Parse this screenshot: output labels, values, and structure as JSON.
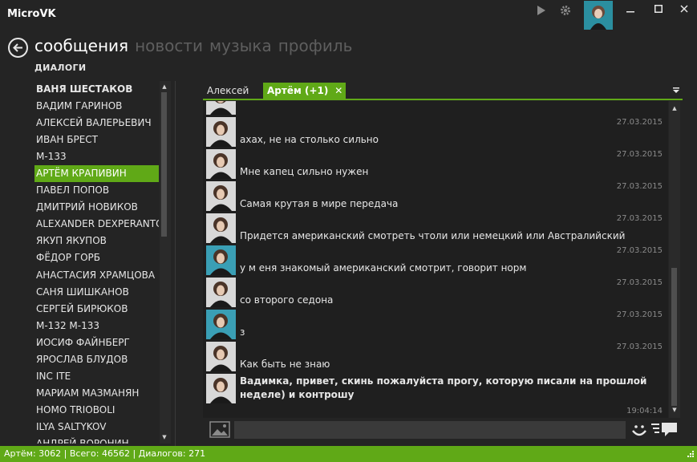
{
  "window": {
    "title": "MicroVK"
  },
  "nav": {
    "items": [
      {
        "label": "сообщения",
        "active": true
      },
      {
        "label": "новости",
        "active": false
      },
      {
        "label": "музыка",
        "active": false
      },
      {
        "label": "профиль",
        "active": false
      }
    ]
  },
  "section_label": "ДИАЛОГИ",
  "contacts": [
    {
      "name": "Ваня Шестаков",
      "bold": true
    },
    {
      "name": "Вадим Гаринов"
    },
    {
      "name": "Алексей Валерьевич"
    },
    {
      "name": "Иван Брест"
    },
    {
      "name": "М-133"
    },
    {
      "name": "Артём Крапивин",
      "selected": true
    },
    {
      "name": "Павел Попов"
    },
    {
      "name": "Дмитрий Новиков"
    },
    {
      "name": "Alexander DexperantO"
    },
    {
      "name": "Якуп Якупов"
    },
    {
      "name": "Фёдор Горб"
    },
    {
      "name": "Анастасия Храмцова"
    },
    {
      "name": "Саня Шишканов"
    },
    {
      "name": "Сергей Бирюков"
    },
    {
      "name": "М-132 М-133"
    },
    {
      "name": "Иосиф Файнберг"
    },
    {
      "name": "Ярослав Блудов"
    },
    {
      "name": "INC ITE"
    },
    {
      "name": "Мариам Мазманян"
    },
    {
      "name": "Homo Trioboli"
    },
    {
      "name": "Ilya Saltykov"
    },
    {
      "name": "Андрей Воронин"
    }
  ],
  "tabs": [
    {
      "label": "Алексей",
      "active": false
    },
    {
      "label": "Артём (+1)",
      "active": true,
      "close": "✕"
    }
  ],
  "messages": [
    {
      "text": "",
      "date": "27.03.2015"
    },
    {
      "text": "ахах, не на столько сильно",
      "date": "27.03.2015"
    },
    {
      "text": "Мне капец сильно нужен",
      "date": "27.03.2015"
    },
    {
      "text": "Самая крутая в мире передача",
      "date": "27.03.2015"
    },
    {
      "text": "Придется американский смотреть чтоли или немецкий или Австралийский",
      "date": "27.03.2015"
    },
    {
      "text": "у м еня знакомый американский смотрит, говорит норм",
      "date": "27.03.2015"
    },
    {
      "text": "со второго седона",
      "date": "27.03.2015"
    },
    {
      "text": "з",
      "date": "27.03.2015"
    },
    {
      "text": "Как быть не знаю",
      "date": "27.03.2015"
    },
    {
      "text": "Вадимка, привет, скинь пожалуйста прогу, которую писали на прошлой неделе) и контрошу",
      "date": "19:04:14",
      "bold": true
    }
  ],
  "composer": {
    "value": ""
  },
  "status": {
    "text": "Артём: 3062 | Всего: 46562 | Диалогов: 271"
  },
  "colors": {
    "accent": "#60a917",
    "background": "#242424"
  },
  "icons": {
    "play": "play-icon",
    "settings": "gear-icon",
    "back": "back-arrow-icon",
    "attach": "image-icon",
    "smile": "smile-icon",
    "send": "chat-bubble-icon",
    "tab_menu": "menu-icon"
  }
}
